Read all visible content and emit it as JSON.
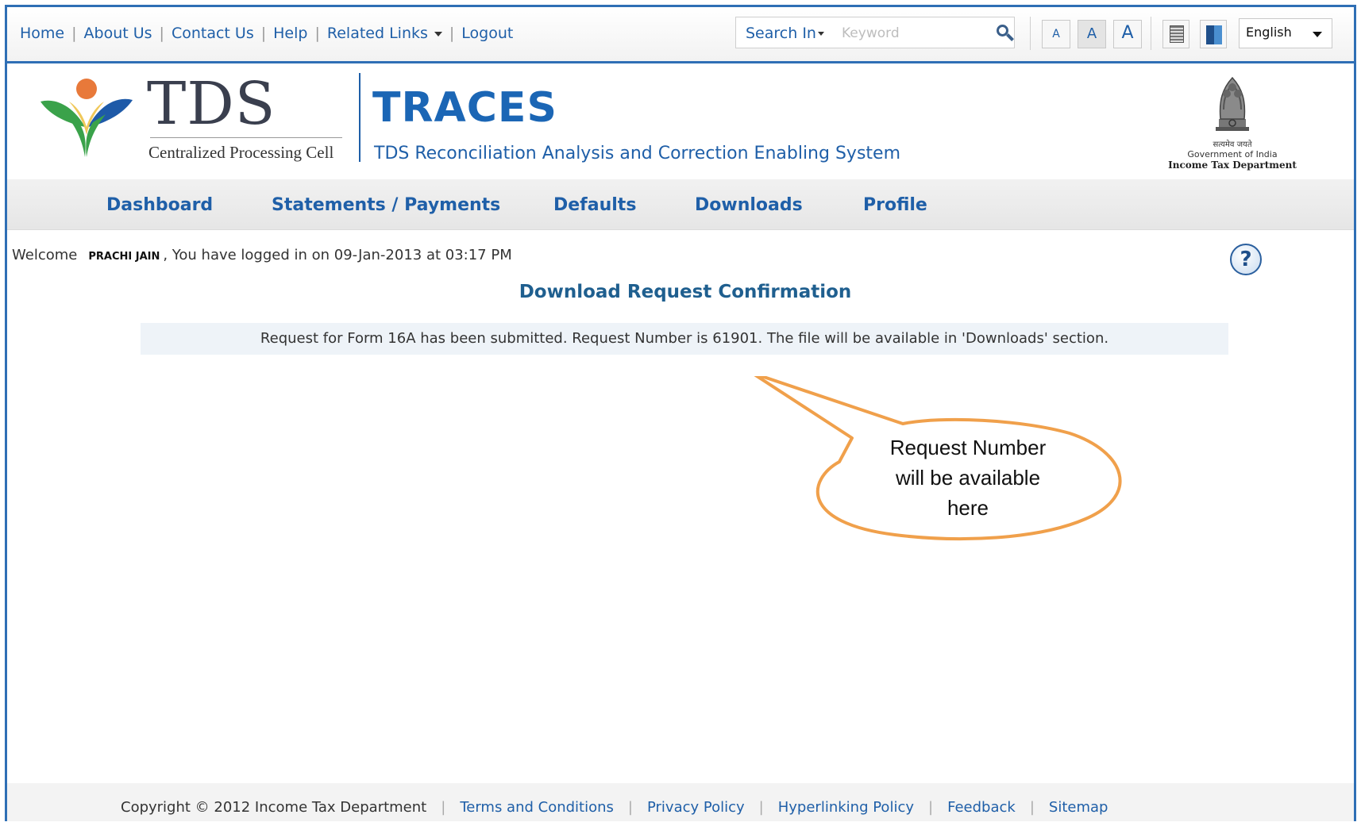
{
  "topbar": {
    "links": [
      "Home",
      "About Us",
      "Contact Us",
      "Help",
      "Related Links",
      "Logout"
    ],
    "search_in_label": "Search In",
    "search_placeholder": "Keyword",
    "font_small": "A",
    "font_medium": "A",
    "font_large": "A",
    "language": "English"
  },
  "header": {
    "tds": "TDS",
    "tds_sub": "Centralized Processing Cell",
    "traces": "TRACES",
    "traces_sub": "TDS Reconciliation Analysis and Correction Enabling System",
    "emblem_hindi": "सत्यमेव जयते",
    "emblem_goi": "Government of India",
    "emblem_itd": "Income Tax Department"
  },
  "nav": {
    "items": [
      "Dashboard",
      "Statements / Payments",
      "Defaults",
      "Downloads",
      "Profile"
    ]
  },
  "content": {
    "welcome_prefix": "Welcome",
    "user_name": "PRACHI JAIN",
    "login_info": ", You have logged in on 09-Jan-2013 at 03:17 PM",
    "help_glyph": "?",
    "page_title": "Download Request Confirmation",
    "message": "Request for Form 16A has been submitted. Request Number is 61901. The file will be available in 'Downloads' section.",
    "callout_lines": [
      "Request Number",
      "will be available",
      "here"
    ]
  },
  "footer": {
    "copyright": "Copyright © 2012 Income Tax Department",
    "links": [
      "Terms and Conditions",
      "Privacy Policy",
      "Hyperlinking Policy",
      "Feedback",
      "Sitemap"
    ]
  },
  "colors": {
    "brand_blue": "#1f5fa8",
    "frame_blue": "#2f6fb5",
    "callout_orange": "#f0a04b"
  }
}
